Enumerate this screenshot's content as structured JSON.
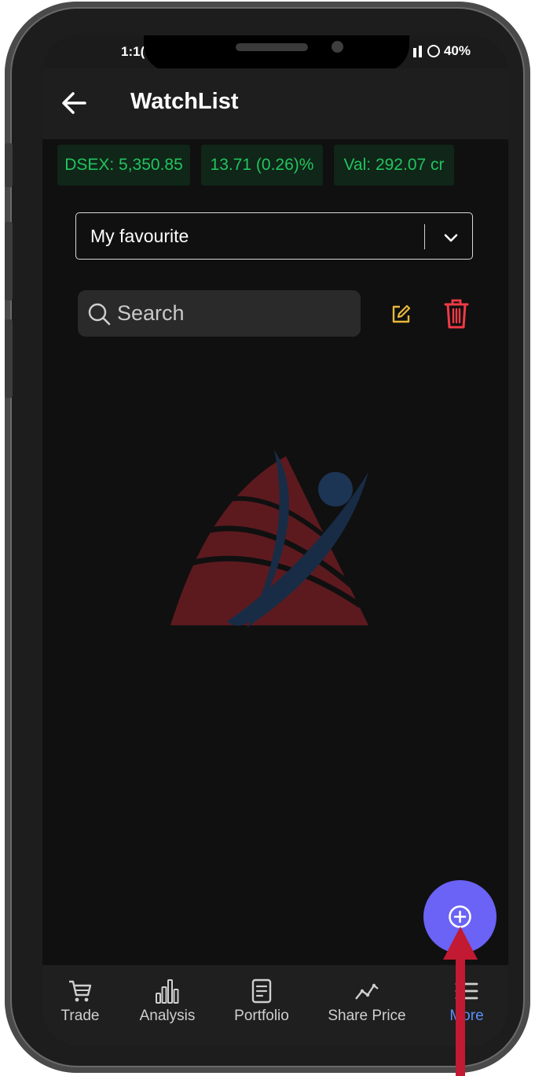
{
  "status_bar": {
    "time": "1:1(",
    "battery": "40%"
  },
  "header": {
    "title": "WatchList"
  },
  "ticker": {
    "index": "DSEX: 5,350.85",
    "change": "13.71 (0.26)%",
    "value": "Val: 292.07 cr"
  },
  "watchlist_select": {
    "selected": "My favourite"
  },
  "search": {
    "placeholder": "Search"
  },
  "colors": {
    "accent": "#6a63f6",
    "positive": "#22c35e",
    "edit": "#e9b73a",
    "delete": "#f03a46",
    "active_nav": "#5b8ff8"
  },
  "bottom_nav": {
    "items": [
      {
        "label": "Trade",
        "icon": "cart-icon"
      },
      {
        "label": "Analysis",
        "icon": "bar-chart-icon"
      },
      {
        "label": "Portfolio",
        "icon": "document-icon"
      },
      {
        "label": "Share Price",
        "icon": "trend-line-icon"
      },
      {
        "label": "More",
        "icon": "menu-icon"
      }
    ]
  }
}
